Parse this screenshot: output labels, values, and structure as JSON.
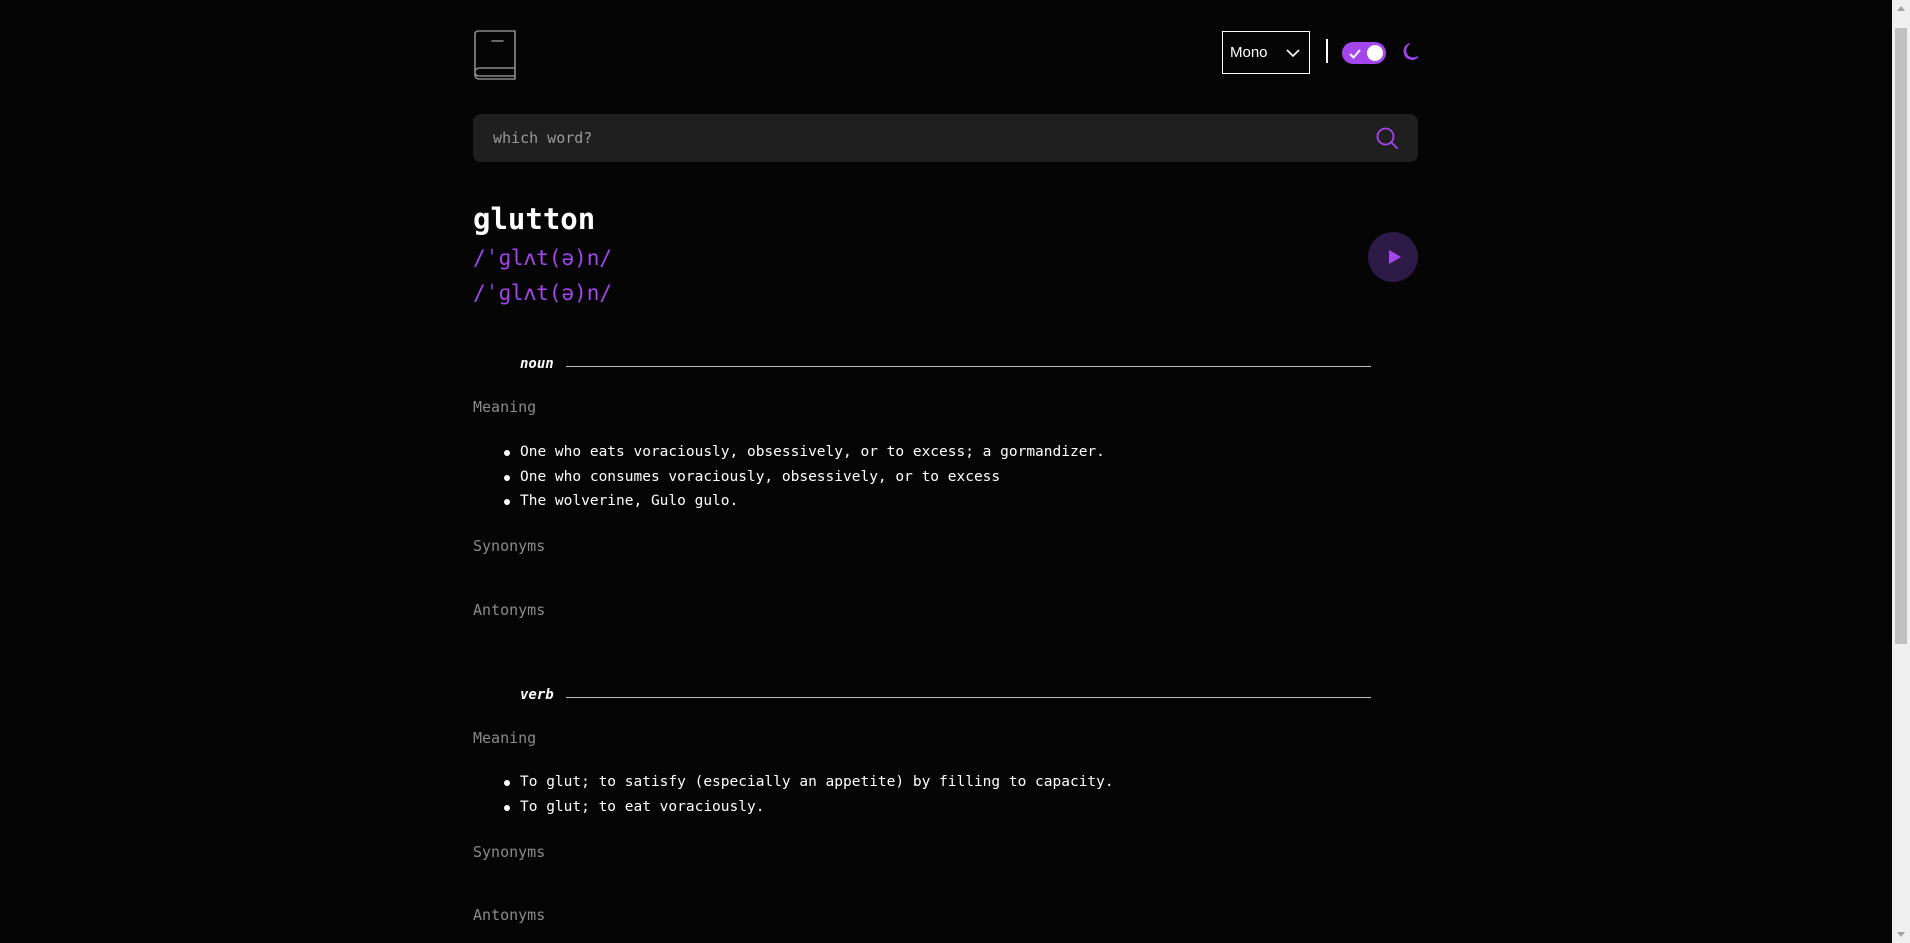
{
  "header": {
    "font_selected": "Mono",
    "theme_toggle_on": true
  },
  "search": {
    "placeholder": "which word?",
    "value": ""
  },
  "entry": {
    "word": "glutton",
    "phonetics": [
      "/ˈɡlʌt(ə)n/",
      "/ˈɡlʌt(ə)n/"
    ]
  },
  "meanings": [
    {
      "part_of_speech": "noun",
      "meaning_label": "Meaning",
      "definitions": [
        "One who eats voraciously, obsessively, or to excess; a gormandizer.",
        "One who consumes voraciously, obsessively, or to excess",
        "The wolverine, Gulo gulo."
      ],
      "synonyms_label": "Synonyms",
      "antonyms_label": "Antonyms"
    },
    {
      "part_of_speech": "verb",
      "meaning_label": "Meaning",
      "definitions": [
        "To glut; to satisfy (especially an appetite) by filling to capacity.",
        "To glut; to eat voraciously."
      ],
      "synonyms_label": "Synonyms",
      "antonyms_label": "Antonyms"
    }
  ],
  "colors": {
    "accent": "#a445ed",
    "background": "#050505",
    "search_bg": "#1f1f1f",
    "play_bg": "#2e1a47"
  },
  "icons": {
    "logo": "book-icon",
    "select": "chevron-down-icon",
    "toggle": "check-icon",
    "theme": "moon-icon",
    "search": "search-icon",
    "play": "play-icon"
  }
}
